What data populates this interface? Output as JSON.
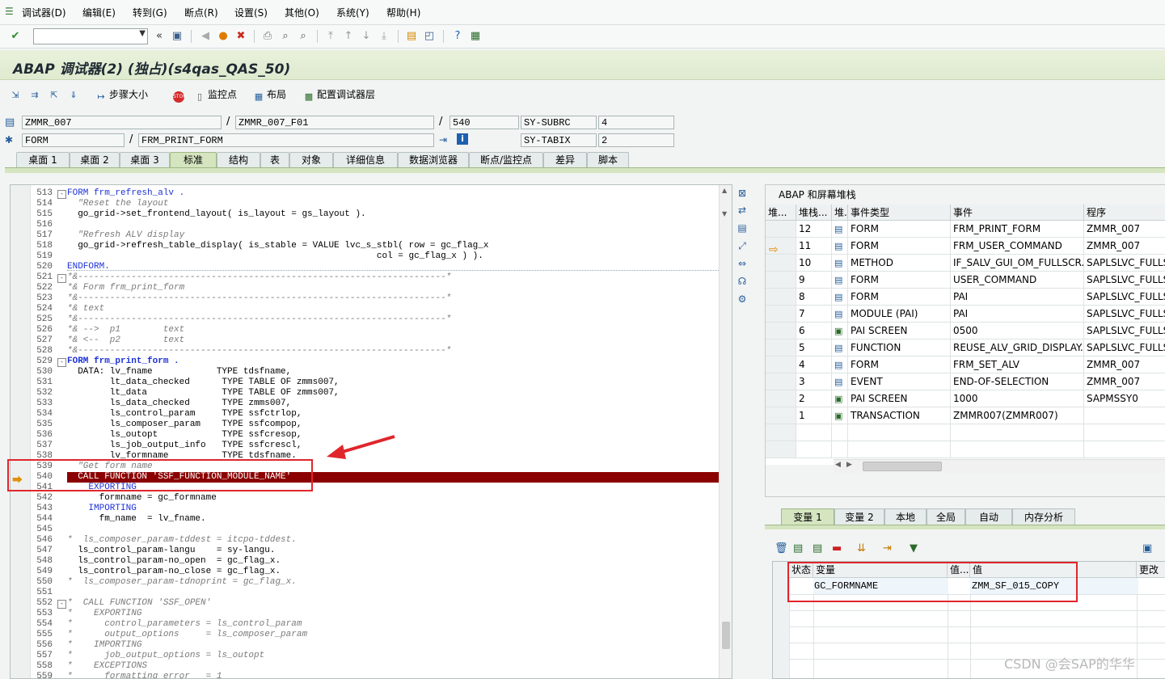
{
  "menu": [
    "调试器(D)",
    "编辑(E)",
    "转到(G)",
    "断点(R)",
    "设置(S)",
    "其他(O)",
    "系统(Y)",
    "帮助(H)"
  ],
  "title": "ABAP 调试器(2)  (独占)(s4qas_QAS_50)",
  "app_toolbar": {
    "step_size": "步骤大小",
    "watchpoint": "监控点",
    "layout": "布局",
    "config_layers": "配置调试器层"
  },
  "fields": {
    "program": "ZMMR_007",
    "include": "ZMMR_007_F01",
    "line": "540",
    "sy_subrc_label": "SY-SUBRC",
    "sy_subrc_value": "4",
    "event_type": "FORM",
    "event": "FRM_PRINT_FORM",
    "sy_tabix_label": "SY-TABIX",
    "sy_tabix_value": "2"
  },
  "tabs": [
    "桌面 1",
    "桌面 2",
    "桌面 3",
    "标准",
    "结构",
    "表",
    "对象",
    "详细信息",
    "数据浏览器",
    "断点/监控点",
    "差异",
    "脚本"
  ],
  "active_tab": "标准",
  "code_lines": [
    {
      "n": "513",
      "t": "FORM frm_refresh_alv ."
    },
    {
      "n": "514",
      "t": "  \"Reset the layout"
    },
    {
      "n": "515",
      "t": "  go_grid->set_frontend_layout( is_layout = gs_layout )."
    },
    {
      "n": "516",
      "t": ""
    },
    {
      "n": "517",
      "t": "  \"Refresh ALV display"
    },
    {
      "n": "518",
      "t": "  go_grid->refresh_table_display( is_stable = VALUE lvc_s_stbl( row = gc_flag_x"
    },
    {
      "n": "519",
      "t": "                                                          col = gc_flag_x ) )."
    },
    {
      "n": "520",
      "t": "ENDFORM."
    },
    {
      "n": "521",
      "t": "*&---------------------------------------------------------------------*"
    },
    {
      "n": "522",
      "t": "*& Form frm_print_form"
    },
    {
      "n": "523",
      "t": "*&---------------------------------------------------------------------*"
    },
    {
      "n": "524",
      "t": "*& text"
    },
    {
      "n": "525",
      "t": "*&---------------------------------------------------------------------*"
    },
    {
      "n": "526",
      "t": "*& -->  p1        text"
    },
    {
      "n": "527",
      "t": "*& <--  p2        text"
    },
    {
      "n": "528",
      "t": "*&---------------------------------------------------------------------*"
    },
    {
      "n": "529",
      "t": "FORM frm_print_form ."
    },
    {
      "n": "530",
      "t": "  DATA: lv_fname            TYPE tdsfname,"
    },
    {
      "n": "531",
      "t": "        lt_data_checked      TYPE TABLE OF zmms007,"
    },
    {
      "n": "532",
      "t": "        lt_data              TYPE TABLE OF zmms007,"
    },
    {
      "n": "533",
      "t": "        ls_data_checked      TYPE zmms007,"
    },
    {
      "n": "534",
      "t": "        ls_control_param     TYPE ssfctrlop,"
    },
    {
      "n": "535",
      "t": "        ls_composer_param    TYPE ssfcompop,"
    },
    {
      "n": "536",
      "t": "        ls_outopt            TYPE ssfcresop,"
    },
    {
      "n": "537",
      "t": "        ls_job_output_info   TYPE ssfcrescl,"
    },
    {
      "n": "538",
      "t": "        lv_formname          TYPE tdsfname."
    },
    {
      "n": "539",
      "t": "  \"Get form name"
    },
    {
      "n": "540",
      "t": "  CALL FUNCTION 'SSF_FUNCTION_MODULE_NAME'"
    },
    {
      "n": "541",
      "t": "    EXPORTING"
    },
    {
      "n": "542",
      "t": "      formname = gc_formname"
    },
    {
      "n": "543",
      "t": "    IMPORTING"
    },
    {
      "n": "544",
      "t": "      fm_name  = lv_fname."
    },
    {
      "n": "545",
      "t": ""
    },
    {
      "n": "546",
      "t": "*  ls_composer_param-tddest = itcpo-tddest."
    },
    {
      "n": "547",
      "t": "  ls_control_param-langu    = sy-langu."
    },
    {
      "n": "548",
      "t": "  ls_control_param-no_open  = gc_flag_x."
    },
    {
      "n": "549",
      "t": "  ls_control_param-no_close = gc_flag_x."
    },
    {
      "n": "550",
      "t": "*  ls_composer_param-tdnoprint = gc_flag_x."
    },
    {
      "n": "551",
      "t": ""
    },
    {
      "n": "552",
      "t": "*  CALL FUNCTION 'SSF_OPEN'"
    },
    {
      "n": "553",
      "t": "*    EXPORTING"
    },
    {
      "n": "554",
      "t": "*      control_parameters = ls_control_param"
    },
    {
      "n": "555",
      "t": "*      output_options     = ls_composer_param"
    },
    {
      "n": "556",
      "t": "*    IMPORTING"
    },
    {
      "n": "557",
      "t": "*      job_output_options = ls_outopt"
    },
    {
      "n": "558",
      "t": "*    EXCEPTIONS"
    },
    {
      "n": "559",
      "t": "*      formatting_error   = 1"
    }
  ],
  "stack": {
    "header": "ABAP 和屏幕堆栈",
    "columns": [
      "堆...",
      "堆栈...",
      "堆...",
      "事件类型",
      "事件",
      "程序"
    ],
    "rows": [
      {
        "depth": "12",
        "type": "FORM",
        "event": "FRM_PRINT_FORM",
        "program": "ZMMR_007",
        "icon": "form"
      },
      {
        "depth": "11",
        "type": "FORM",
        "event": "FRM_USER_COMMAND",
        "program": "ZMMR_007",
        "icon": "form"
      },
      {
        "depth": "10",
        "type": "METHOD",
        "event": "IF_SALV_GUI_OM_FULLSCR...",
        "program": "SAPLSLVC_FULLSC",
        "icon": "form"
      },
      {
        "depth": "9",
        "type": "FORM",
        "event": "USER_COMMAND",
        "program": "SAPLSLVC_FULLSC",
        "icon": "form"
      },
      {
        "depth": "8",
        "type": "FORM",
        "event": "PAI",
        "program": "SAPLSLVC_FULLSC",
        "icon": "form"
      },
      {
        "depth": "7",
        "type": "MODULE (PAI)",
        "event": "PAI",
        "program": "SAPLSLVC_FULLSC",
        "icon": "form"
      },
      {
        "depth": "6",
        "type": "PAI SCREEN",
        "event": "0500",
        "program": "SAPLSLVC_FULLSC",
        "icon": "screen"
      },
      {
        "depth": "5",
        "type": "FUNCTION",
        "event": "REUSE_ALV_GRID_DISPLAY...",
        "program": "SAPLSLVC_FULLSC",
        "icon": "form"
      },
      {
        "depth": "4",
        "type": "FORM",
        "event": "FRM_SET_ALV",
        "program": "ZMMR_007",
        "icon": "form"
      },
      {
        "depth": "3",
        "type": "EVENT",
        "event": "END-OF-SELECTION",
        "program": "ZMMR_007",
        "icon": "form"
      },
      {
        "depth": "2",
        "type": "PAI SCREEN",
        "event": "1000",
        "program": "SAPMSSY0",
        "icon": "screen"
      },
      {
        "depth": "1",
        "type": "TRANSACTION",
        "event": "ZMMR007(ZMMR007)",
        "program": "",
        "icon": "screen"
      }
    ]
  },
  "var_tabs": [
    "变量 1",
    "变量 2",
    "本地",
    "全局",
    "自动",
    "内存分析"
  ],
  "var_grid": {
    "columns": [
      "状态",
      "变量",
      "值...",
      "值",
      "更改"
    ],
    "rows": [
      {
        "name": "GC_FORMNAME",
        "value": "ZMM_SF_015_COPY"
      }
    ]
  },
  "watermark": "CSDN @会SAP的华华"
}
